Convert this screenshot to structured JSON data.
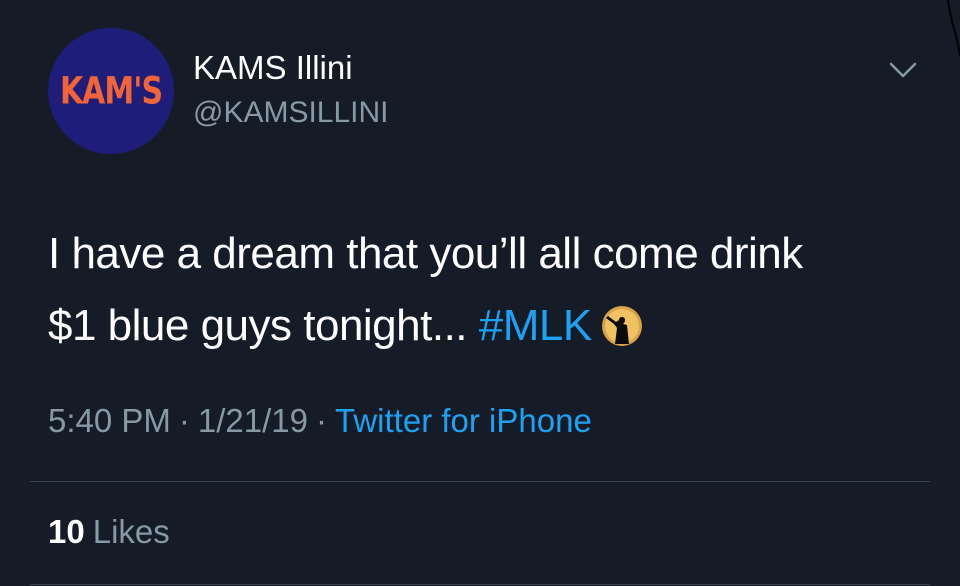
{
  "user": {
    "display_name": "KAMS Illini",
    "handle": "@KAMSILLINI",
    "avatar_text": "KAM'S"
  },
  "tweet": {
    "line1": "I have a dream that you’ll all come drink",
    "line2_text": "$1 blue guys tonight... ",
    "hashtag": "#MLK",
    "emoji": "silhouette-speaker-emoji"
  },
  "meta": {
    "time": "5:40 PM",
    "date": "1/21/19",
    "separator": "·",
    "source": "Twitter for iPhone"
  },
  "stats": {
    "likes_count": "10",
    "likes_label": "Likes"
  },
  "colors": {
    "background": "#151c28",
    "link": "#1da1f2",
    "secondary_text": "#8899a6",
    "avatar_bg": "#1f1d7a",
    "avatar_text": "#f26437"
  }
}
